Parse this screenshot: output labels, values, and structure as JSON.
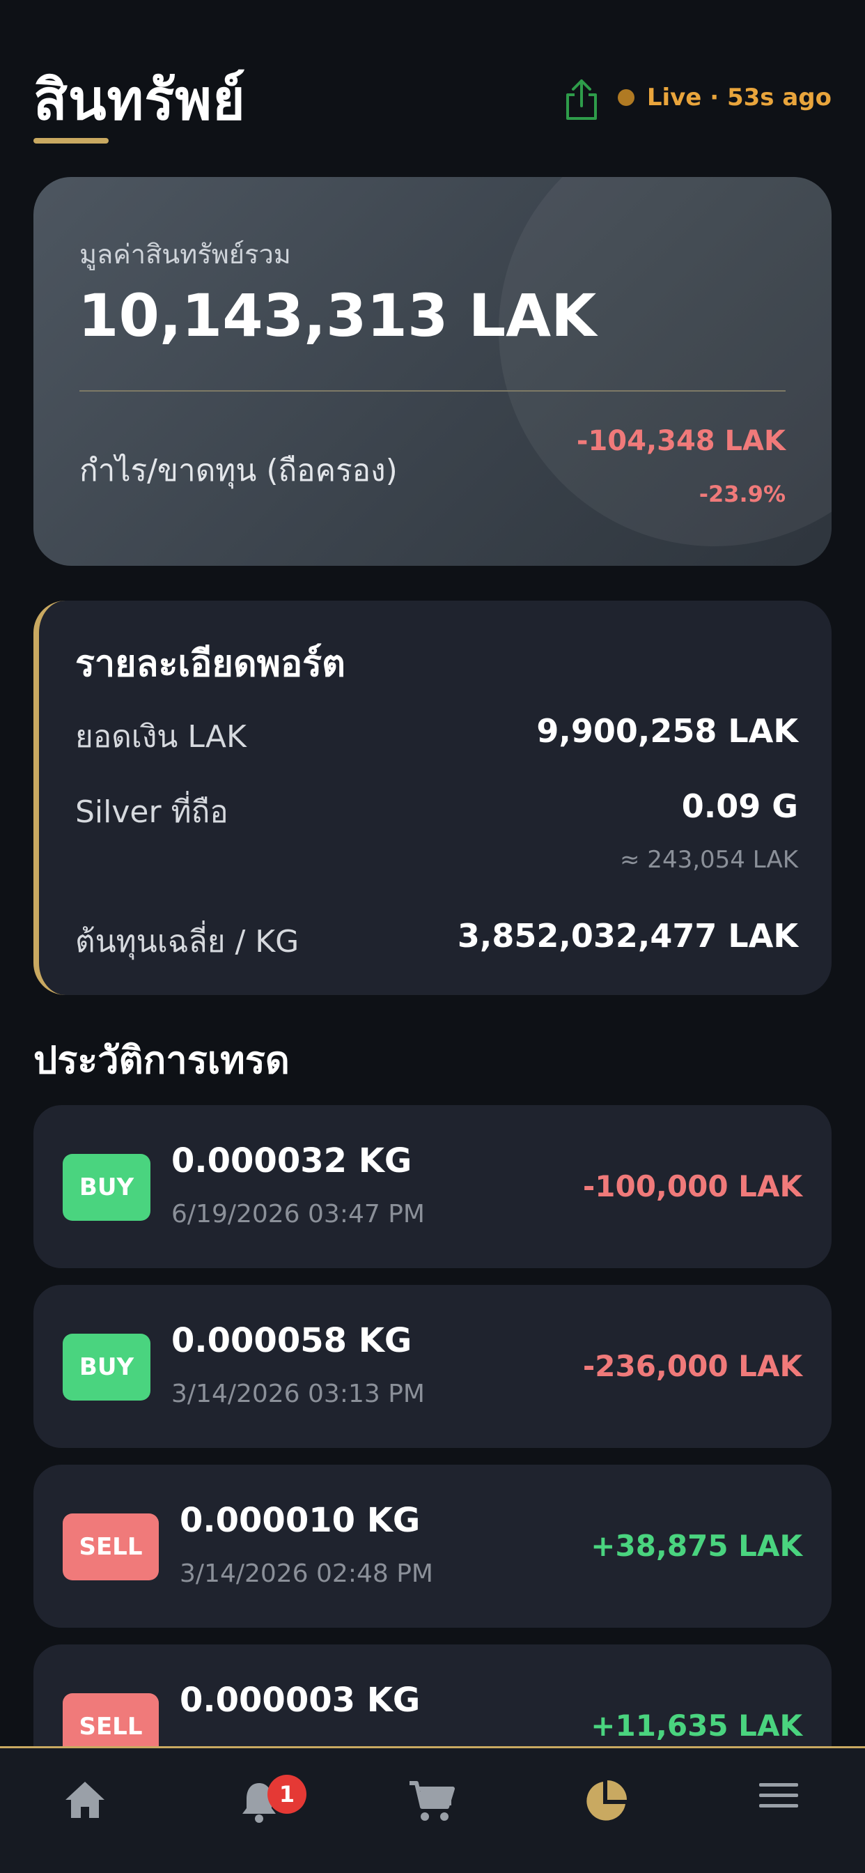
{
  "header": {
    "title": "สินทรัพย์",
    "live_status": "Live · 53s ago",
    "share_icon": "share-icon"
  },
  "total": {
    "label": "มูลค่าสินทรัพย์รวม",
    "value": "10,143,313 LAK",
    "pl_label": "กำไร/ขาดทุน (ถือครอง)",
    "pl_amount": "-104,348 LAK",
    "pl_percent": "-23.9%"
  },
  "portfolio": {
    "heading": "รายละเอียดพอร์ต",
    "rows": [
      {
        "label": "ยอดเงิน LAK",
        "value": "9,900,258 LAK"
      },
      {
        "label": "Silver ที่ถือ",
        "value": "0.09 G",
        "sub": "≈ 243,054 LAK"
      },
      {
        "label": "ต้นทุนเฉลี่ย / KG",
        "value": "3,852,032,477 LAK"
      }
    ]
  },
  "history": {
    "title": "ประวัติการเทรด",
    "trades": [
      {
        "type": "BUY",
        "qty": "0.000032 KG",
        "date": "6/19/2026 03:47 PM",
        "amount": "-100,000 LAK"
      },
      {
        "type": "BUY",
        "qty": "0.000058 KG",
        "date": "3/14/2026 03:13 PM",
        "amount": "-236,000 LAK"
      },
      {
        "type": "SELL",
        "qty": "0.000010 KG",
        "date": "3/14/2026 02:48 PM",
        "amount": "+38,875 LAK"
      },
      {
        "type": "SELL",
        "qty": "0.000003 KG",
        "date": "",
        "amount": "+11,635 LAK"
      }
    ]
  },
  "nav": {
    "items": [
      {
        "icon": "home-icon"
      },
      {
        "icon": "bell-icon",
        "badge": "1"
      },
      {
        "icon": "cart-icon"
      },
      {
        "icon": "pie-chart-icon",
        "active": true
      },
      {
        "icon": "menu-icon"
      }
    ]
  },
  "colors": {
    "accent_gold": "#c9a961",
    "live_orange": "#e9a53c",
    "buy_green": "#4ad47f",
    "sell_red": "#f07a7a",
    "share_green": "#2e9c4a"
  }
}
